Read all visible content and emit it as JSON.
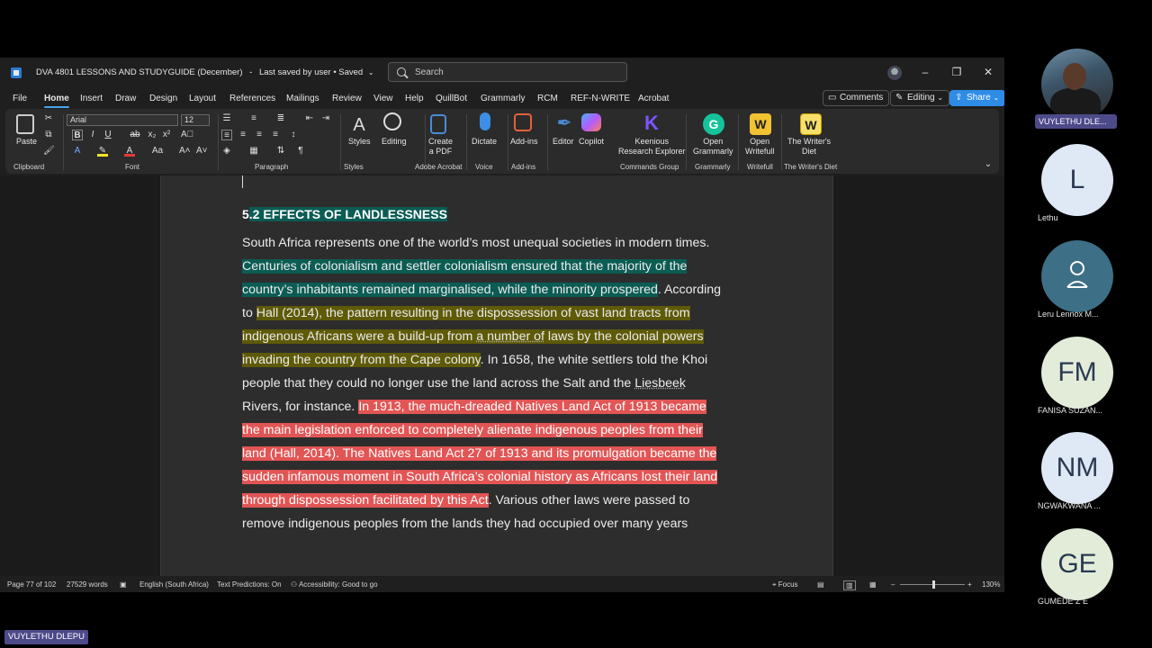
{
  "window": {
    "doc_title": "DVA 4801 LESSONS AND STUDYGUIDE (December)",
    "save_status": "Last saved by user • Saved",
    "search_placeholder": "Search"
  },
  "menu": [
    "File",
    "Home",
    "Insert",
    "Draw",
    "Design",
    "Layout",
    "References",
    "Mailings",
    "Review",
    "View",
    "Help",
    "QuillBot",
    "Grammarly",
    "RCM",
    "REF-N-WRITE",
    "Acrobat"
  ],
  "top_buttons": {
    "comments": "Comments",
    "editing": "Editing",
    "share": "Share"
  },
  "ribbon": {
    "paste": "Paste",
    "clipboard": "Clipboard",
    "font_name": "Arial",
    "font_size": "12",
    "font": "Font",
    "paragraph": "Paragraph",
    "styles": "Styles",
    "styles_group": "Styles",
    "editing": "Editing",
    "create_pdf_1": "Create",
    "create_pdf_2": "a PDF",
    "adobe_acrobat": "Adobe Acrobat",
    "dictate": "Dictate",
    "voice": "Voice",
    "addins": "Add-ins",
    "addins_group": "Add-ins",
    "editor": "Editor",
    "copilot": "Copilot",
    "keenious_1": "Keenious",
    "keenious_2": "Research Explorer",
    "commands_group": "Commands Group",
    "open_grammarly_1": "Open",
    "open_grammarly_2": "Grammarly",
    "grammarly_group": "Grammarly",
    "open_writefull_1": "Open",
    "open_writefull_2": "Writefull",
    "writefull_group": "Writefull",
    "writers_diet_1": "The Writer's",
    "writers_diet_2": "Diet",
    "writers_diet_group": "The Writer's Diet"
  },
  "document": {
    "heading_num": "5",
    "heading_rest": ".2 EFFECTS OF LANDLESSNESS",
    "l1": "South Africa represents one of the world’s most unequal societies in modern times.",
    "l2": "Centuries of colonialism and settler colonialism ensured that the majority of the",
    "l3a": "country’s inhabitants remained marginalised, while the minority prospered",
    "l3b": ". According",
    "l4a": "to ",
    "l4b": "Hall (2014), the pattern resulting in the dispossession of vast land tracts from",
    "l5a": "indigenous Africans were a build-up from ",
    "l5b": "a number of",
    "l5c": " laws by the colonial powers",
    "l6a": "invading the country from the Cape colony",
    "l6b": ". In 1658, the white settlers told the Khoi",
    "l7a": "people that they could no longer use the land across the Salt and the ",
    "l7b": "Liesbeek",
    "l8a": "Rivers, for instance. ",
    "l8b": "In 1913, the much-dreaded Natives Land Act of 1913 became",
    "l9": "the main legislation enforced to completely alienate indigenous peoples from their",
    "l10": "land (Hall, 2014). The Natives Land Act 27 of 1913 and its promulgation became the",
    "l11": "sudden infamous moment in South Africa’s colonial history as Africans lost their land",
    "l12a": "through dispossession facilitated by this Act",
    "l12b": ". Various other laws were passed to",
    "l13": "remove indigenous peoples from the lands they had occupied over many years"
  },
  "status": {
    "page": "Page 77 of 102",
    "words": "27529 words",
    "language": "English (South Africa)",
    "predictions": "Text Predictions: On",
    "accessibility": "Accessibility: Good to go",
    "focus": "Focus",
    "zoom": "130%"
  },
  "participants": [
    {
      "initials": "",
      "name": "VUYLETHU DLE..."
    },
    {
      "initials": "L",
      "name": "Lethu"
    },
    {
      "initials": "",
      "name": "Leru Lennox M..."
    },
    {
      "initials": "FM",
      "name": "FANISA SUZAN..."
    },
    {
      "initials": "NM",
      "name": "NGWAKWANA ..."
    },
    {
      "initials": "GE",
      "name": "GUMEDE Z E"
    }
  ],
  "speaker_name": "VUYLETHU DLEPU",
  "colors": {
    "highlight_teal": "#0b5c54",
    "highlight_olive": "#5e5a08",
    "highlight_red": "#e25555",
    "accent": "#2e8ce6",
    "avatar_bg": "#dfe8f5"
  }
}
